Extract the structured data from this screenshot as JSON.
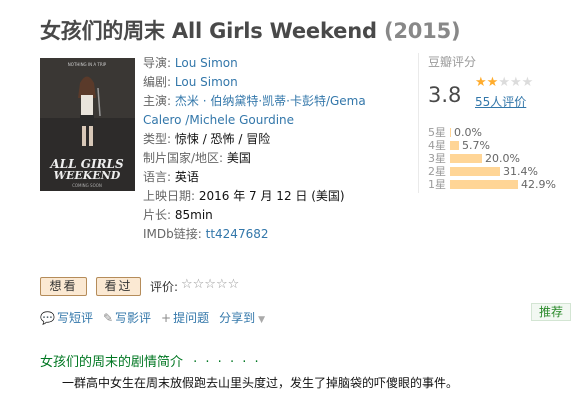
{
  "title": {
    "main": "女孩们的周末 All Girls Weekend",
    "year": "(2015)"
  },
  "poster": {
    "tagline": "NOTHING IN A TRIP",
    "title_line1": "ALL GIRLS",
    "title_line2": "WEEKEND",
    "footer": "COMING SOON"
  },
  "info": {
    "director_label": "导演:",
    "director": "Lou Simon",
    "writer_label": "编剧:",
    "writer": "Lou Simon",
    "cast_label": "主演:",
    "cast_line1": "杰米 · 伯纳黛特·凯蒂·卡彭特/Gema",
    "cast_line2": "Calero /Michele Gourdine",
    "genre_label": "类型:",
    "genre": "惊悚 / 恐怖 / 冒险",
    "country_label": "制片国家/地区:",
    "country": "美国",
    "language_label": "语言:",
    "language": "英语",
    "release_label": "上映日期:",
    "release": "2016 年 7 月 12 日 (美国)",
    "runtime_label": "片长:",
    "runtime": "85min",
    "imdb_label": "IMDb链接:",
    "imdb": "tt4247682"
  },
  "rating": {
    "label": "豆瓣评分",
    "score": "3.8",
    "stars_value": 2,
    "stars_max": 5,
    "votes": "55人评价",
    "bars": [
      {
        "label": "5星",
        "pct_text": "0.0%",
        "value": 0.0
      },
      {
        "label": "4星",
        "pct_text": "5.7%",
        "value": 5.7
      },
      {
        "label": "3星",
        "pct_text": "20.0%",
        "value": 20.0
      },
      {
        "label": "2星",
        "pct_text": "31.4%",
        "value": 31.4
      },
      {
        "label": "1星",
        "pct_text": "42.9%",
        "value": 42.9
      }
    ]
  },
  "buttons": {
    "want": "想看",
    "seen": "看过"
  },
  "my_rating": {
    "label": "评价:",
    "stars": "☆☆☆☆☆"
  },
  "actions": {
    "short_review": "写短评",
    "review": "写影评",
    "question": "提问题",
    "share": "分享到"
  },
  "recommend": "推荐",
  "section": {
    "title": "女孩们的周末的剧情简介",
    "dots": "· · · · · ·"
  },
  "summary": "一群高中女生在周末放假跑去山里头度过，发生了掉脑袋的吓傻眼的事件。",
  "colors": {
    "link": "#3377aa",
    "green": "#007722",
    "bar": "#ffd596",
    "star": "#ffac2d"
  }
}
